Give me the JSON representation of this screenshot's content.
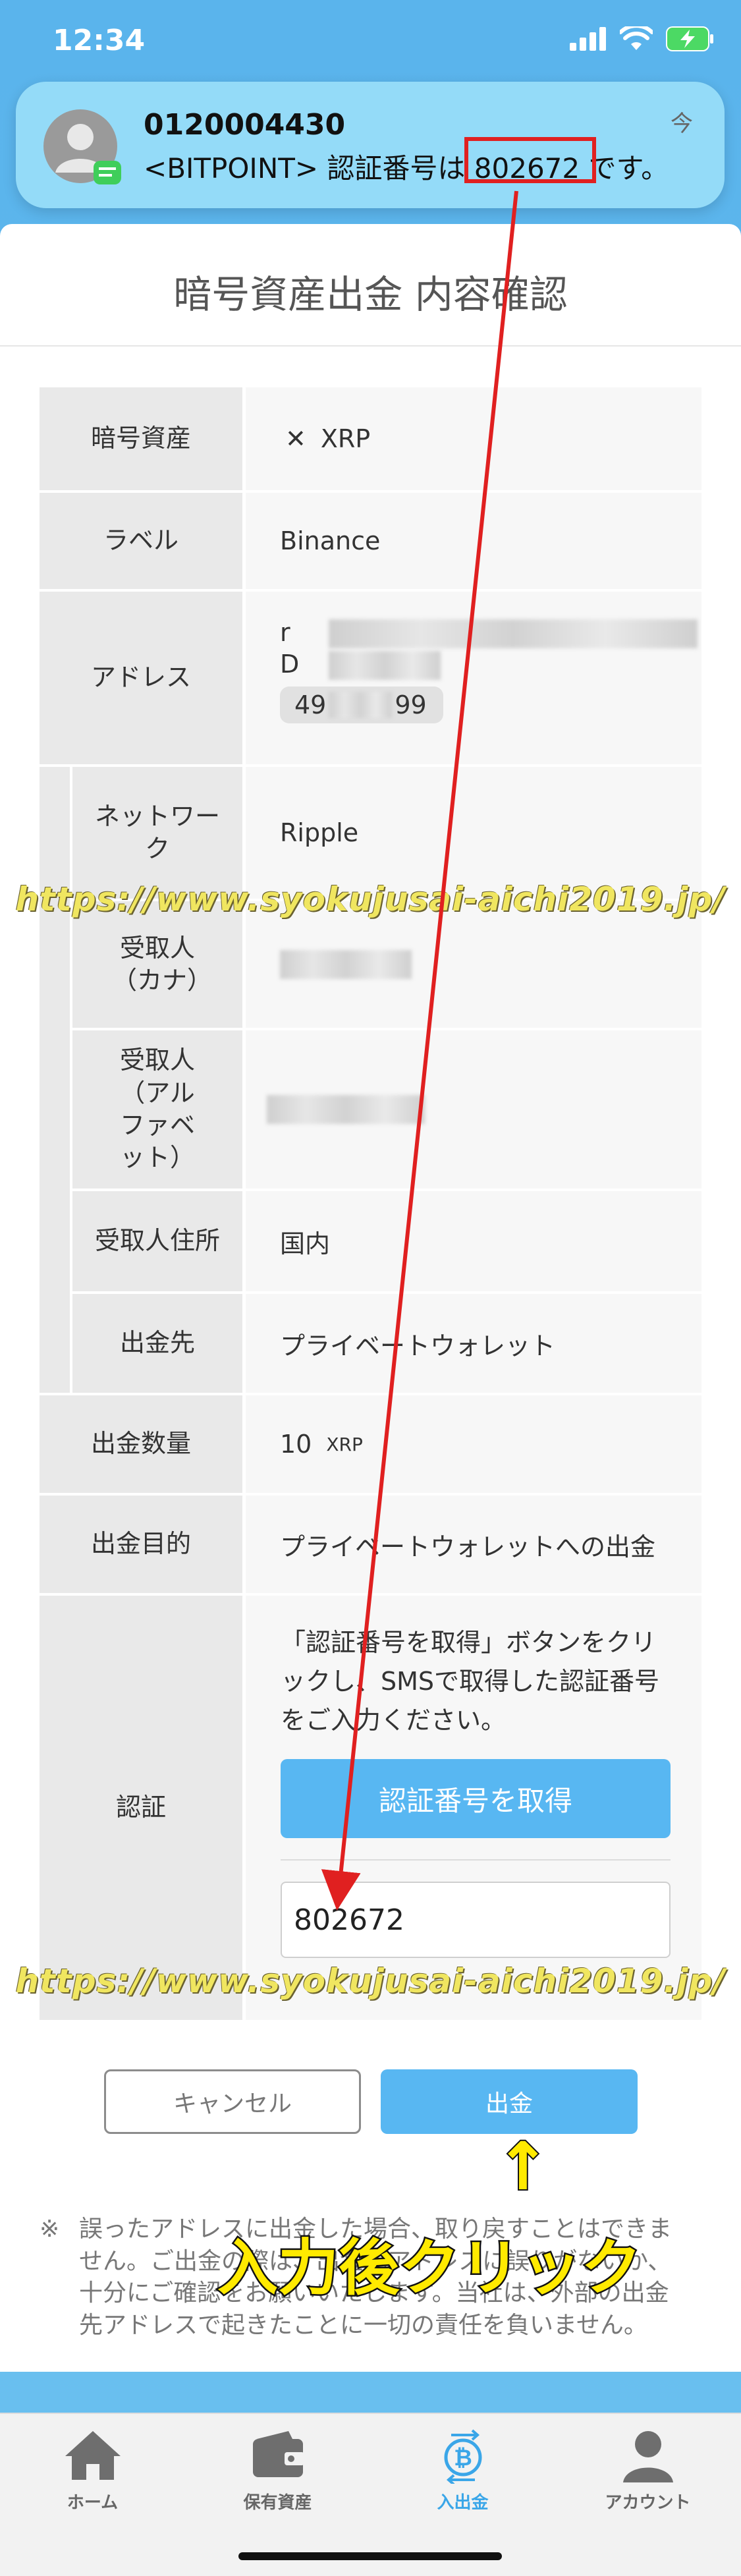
{
  "status_bar": {
    "time": "12:34"
  },
  "notification": {
    "sender": "0120004430",
    "message_prefix": "<BITPOINT> 認証番号は ",
    "code": "802672",
    "message_suffix": " です。",
    "time": "今"
  },
  "page": {
    "title": "暗号資産出金 内容確認"
  },
  "rows": {
    "asset": {
      "label": "暗号資産",
      "icon": "xrp-icon",
      "value": "XRP"
    },
    "label": {
      "label": "ラベル",
      "value": "Binance"
    },
    "address": {
      "label": "アドレス",
      "value_visible": "r",
      "line2_visible": "D",
      "tag_visible": "49",
      "tag_end": "99"
    },
    "network": {
      "label": "ネットワーク",
      "value": "Ripple"
    },
    "recipient_kana": {
      "label": "受取人（カナ）"
    },
    "recipient_alpha": {
      "label": "受取人（アルファベット）"
    },
    "recipient_address": {
      "label": "受取人住所",
      "value": "国内"
    },
    "destination": {
      "label": "出金先",
      "value": "プライベートウォレット"
    },
    "amount": {
      "label": "出金数量",
      "value": "10",
      "unit": "XRP"
    },
    "purpose": {
      "label": "出金目的",
      "value": "プライベートウォレットへの出金"
    },
    "auth": {
      "label": "認証",
      "instruction": "「認証番号を取得」ボタンをクリックし、SMSで取得した認証番号をご入力ください。",
      "get_code_label": "認証番号を取得",
      "code_value": "802672"
    }
  },
  "buttons": {
    "cancel": "キャンセル",
    "withdraw": "出金"
  },
  "disclaimer": {
    "mark": "※",
    "text": "誤ったアドレスに出金した場合、取り戻すことはできません。ご出金の際は、出金先アドレスに誤りがないか、十分にご確認をお願いいたします。当社は、外部の出金先アドレスで起きたことに一切の責任を負いません。"
  },
  "tabs": [
    {
      "label": "ホーム",
      "icon": "home-icon",
      "active": false
    },
    {
      "label": "保有資産",
      "icon": "wallet-icon",
      "active": false
    },
    {
      "label": "入出金",
      "icon": "bitcoin-transfer-icon",
      "active": true
    },
    {
      "label": "アカウント",
      "icon": "account-icon",
      "active": false
    }
  ],
  "overlay": {
    "watermark": "https://www.syokujusai-aichi2019.jp/",
    "caption": "入力後クリック",
    "up_arrow": "↑"
  },
  "colors": {
    "accent": "#58b7f2",
    "annotation_red": "#e02020",
    "caption_yellow": "#ffea00",
    "watermark_yellow": "#f0e660"
  }
}
